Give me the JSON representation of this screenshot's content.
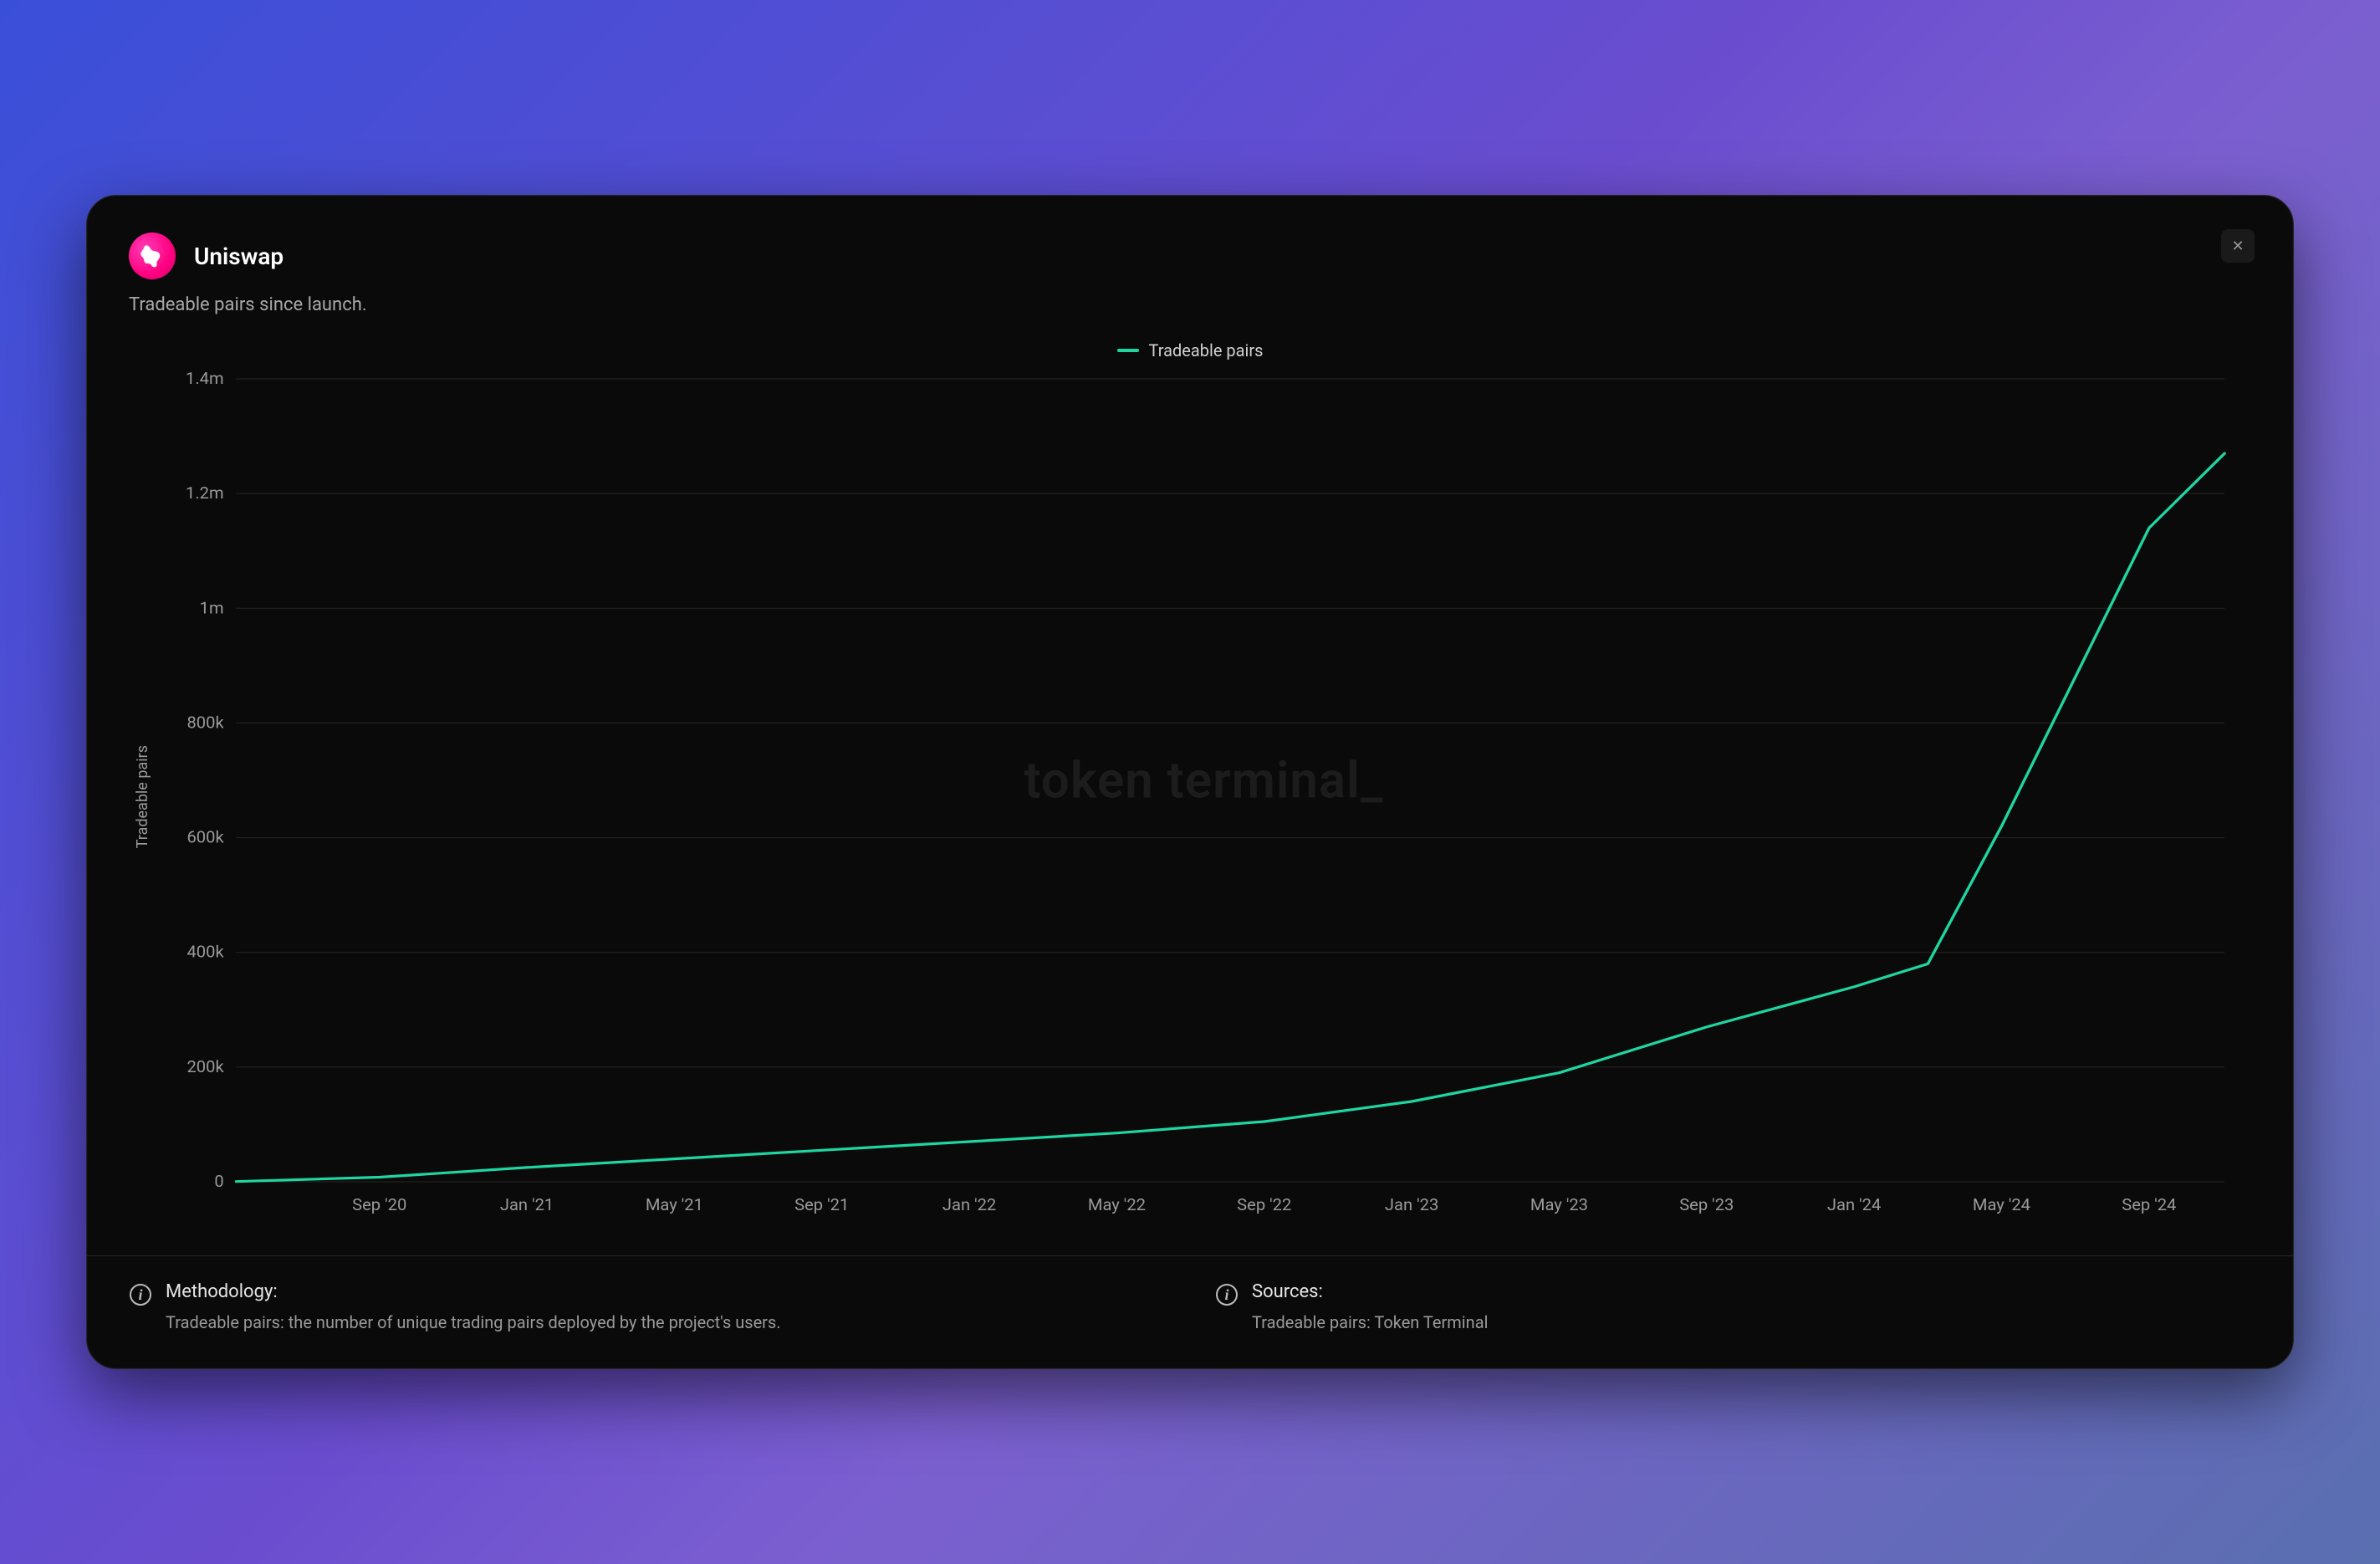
{
  "header": {
    "title": "Uniswap",
    "subtitle": "Tradeable pairs since launch."
  },
  "legend": {
    "label": "Tradeable pairs"
  },
  "watermark": "token terminal_",
  "footer": {
    "methodology": {
      "title": "Methodology:",
      "body": "Tradeable pairs: the number of unique trading pairs deployed by the project's users."
    },
    "sources": {
      "title": "Sources:",
      "body": "Tradeable pairs: Token Terminal"
    }
  },
  "chart_data": {
    "type": "line",
    "title": "Tradeable pairs since launch.",
    "xlabel": "",
    "ylabel": "Tradeable pairs",
    "ylim": [
      0,
      1400000
    ],
    "y_ticks": [
      0,
      200000,
      400000,
      600000,
      800000,
      1000000,
      1200000,
      1400000
    ],
    "y_tick_labels": [
      "0",
      "200k",
      "400k",
      "600k",
      "800k",
      "1m",
      "1.2m",
      "1.4m"
    ],
    "x_tick_labels": [
      "Sep '20",
      "Jan '21",
      "May '21",
      "Sep '21",
      "Jan '22",
      "May '22",
      "Sep '22",
      "Jan '23",
      "May '23",
      "Sep '23",
      "Jan '24",
      "May '24",
      "Sep '24"
    ],
    "series": [
      {
        "name": "Tradeable pairs",
        "color": "#1fd6a1",
        "data": [
          {
            "x": "May '20",
            "y": 500
          },
          {
            "x": "Sep '20",
            "y": 8000
          },
          {
            "x": "Jan '21",
            "y": 25000
          },
          {
            "x": "May '21",
            "y": 40000
          },
          {
            "x": "Sep '21",
            "y": 55000
          },
          {
            "x": "Jan '22",
            "y": 70000
          },
          {
            "x": "May '22",
            "y": 85000
          },
          {
            "x": "Sep '22",
            "y": 105000
          },
          {
            "x": "Jan '23",
            "y": 140000
          },
          {
            "x": "May '23",
            "y": 190000
          },
          {
            "x": "Sep '23",
            "y": 270000
          },
          {
            "x": "Jan '24",
            "y": 340000
          },
          {
            "x": "Mar '24",
            "y": 380000
          },
          {
            "x": "May '24",
            "y": 620000
          },
          {
            "x": "Sep '24",
            "y": 1140000
          },
          {
            "x": "Oct '24",
            "y": 1270000
          }
        ]
      }
    ],
    "legend_position": "top"
  }
}
